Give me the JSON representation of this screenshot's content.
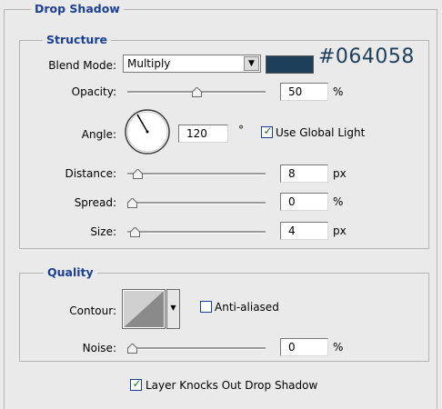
{
  "drop_shadow": {
    "title": "Drop Shadow",
    "structure": {
      "title": "Structure",
      "blend_mode": {
        "label": "Blend Mode:",
        "value": "Multiply"
      },
      "color_hex": "#064058",
      "swatch_color": "#1e3f5a",
      "opacity": {
        "label": "Opacity:",
        "value": "50",
        "unit": "%",
        "slider_level": 0.5
      },
      "angle": {
        "label": "Angle:",
        "value": "120",
        "unit": "°",
        "degrees": 120
      },
      "use_global_light": {
        "label": "Use Global Light",
        "checked": true
      },
      "distance": {
        "label": "Distance:",
        "value": "8",
        "unit": "px",
        "slider_level": 0.04
      },
      "spread": {
        "label": "Spread:",
        "value": "0",
        "unit": "%",
        "slider_level": 0
      },
      "size": {
        "label": "Size:",
        "value": "4",
        "unit": "px",
        "slider_level": 0.02
      }
    },
    "quality": {
      "title": "Quality",
      "contour": {
        "label": "Contour:"
      },
      "anti_aliased": {
        "label": "Anti-aliased",
        "checked": false
      },
      "noise": {
        "label": "Noise:",
        "value": "0",
        "unit": "%",
        "slider_level": 0
      }
    },
    "layer_knocks_out": {
      "label": "Layer Knocks Out Drop Shadow",
      "checked": true
    }
  }
}
